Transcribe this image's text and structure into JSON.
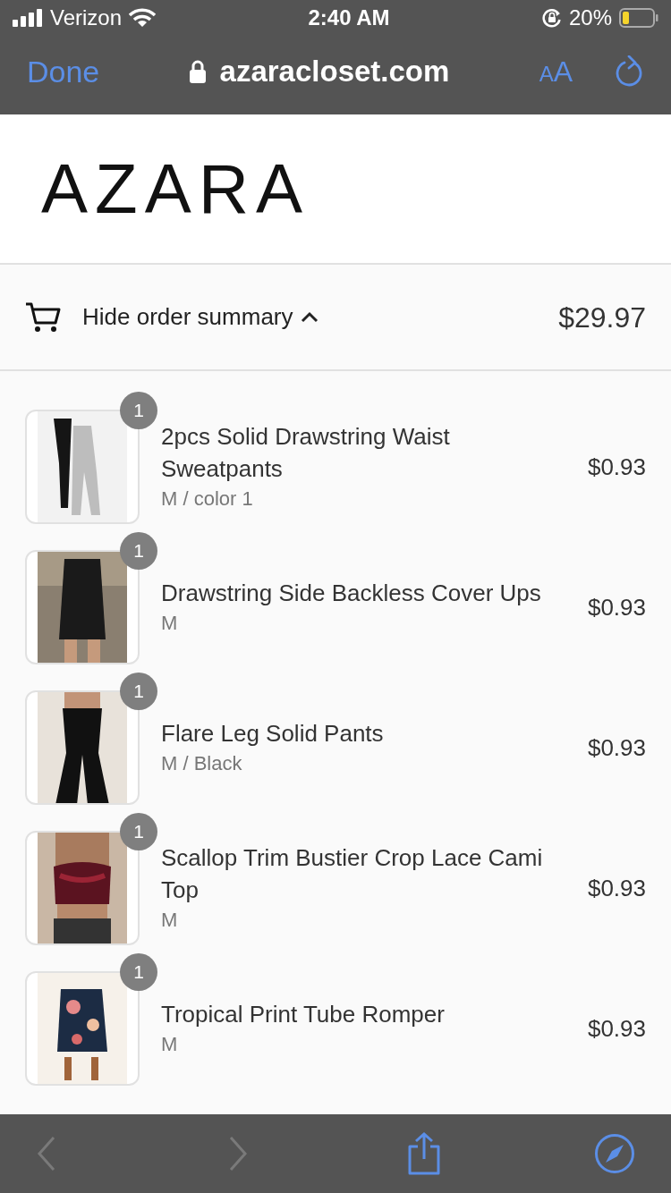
{
  "status_bar": {
    "carrier": "Verizon",
    "time": "2:40 AM",
    "battery": "20%"
  },
  "browser_bar": {
    "done": "Done",
    "url": "azaracloset.com",
    "text_size": {
      "small_letter": "A",
      "large_letter": "A"
    }
  },
  "logo": "AZARA",
  "order_summary": {
    "toggle_label": "Hide order summary",
    "expanded": true,
    "total": "$29.97"
  },
  "items": [
    {
      "quantity": "1",
      "title": "2pcs Solid Drawstring Waist Sweatpants",
      "variant": "M / color 1",
      "price": "$0.93",
      "kind": "picture"
    },
    {
      "quantity": "1",
      "title": "Drawstring Side Backless Cover Ups",
      "variant": "M",
      "price": "$0.93",
      "kind": "picture"
    },
    {
      "quantity": "1",
      "title": "Flare Leg Solid Pants",
      "variant": "M / Black",
      "price": "$0.93",
      "kind": "picture"
    },
    {
      "quantity": "1",
      "title": "Scallop Trim Bustier Crop Lace Cami Top",
      "variant": "M",
      "price": "$0.93",
      "kind": "picture"
    },
    {
      "quantity": "1",
      "title": "Tropical Print Tube Romper",
      "variant": "M",
      "price": "$0.93",
      "kind": "picture"
    }
  ],
  "toolbar": {
    "back_disabled": true,
    "forward_disabled": true
  }
}
